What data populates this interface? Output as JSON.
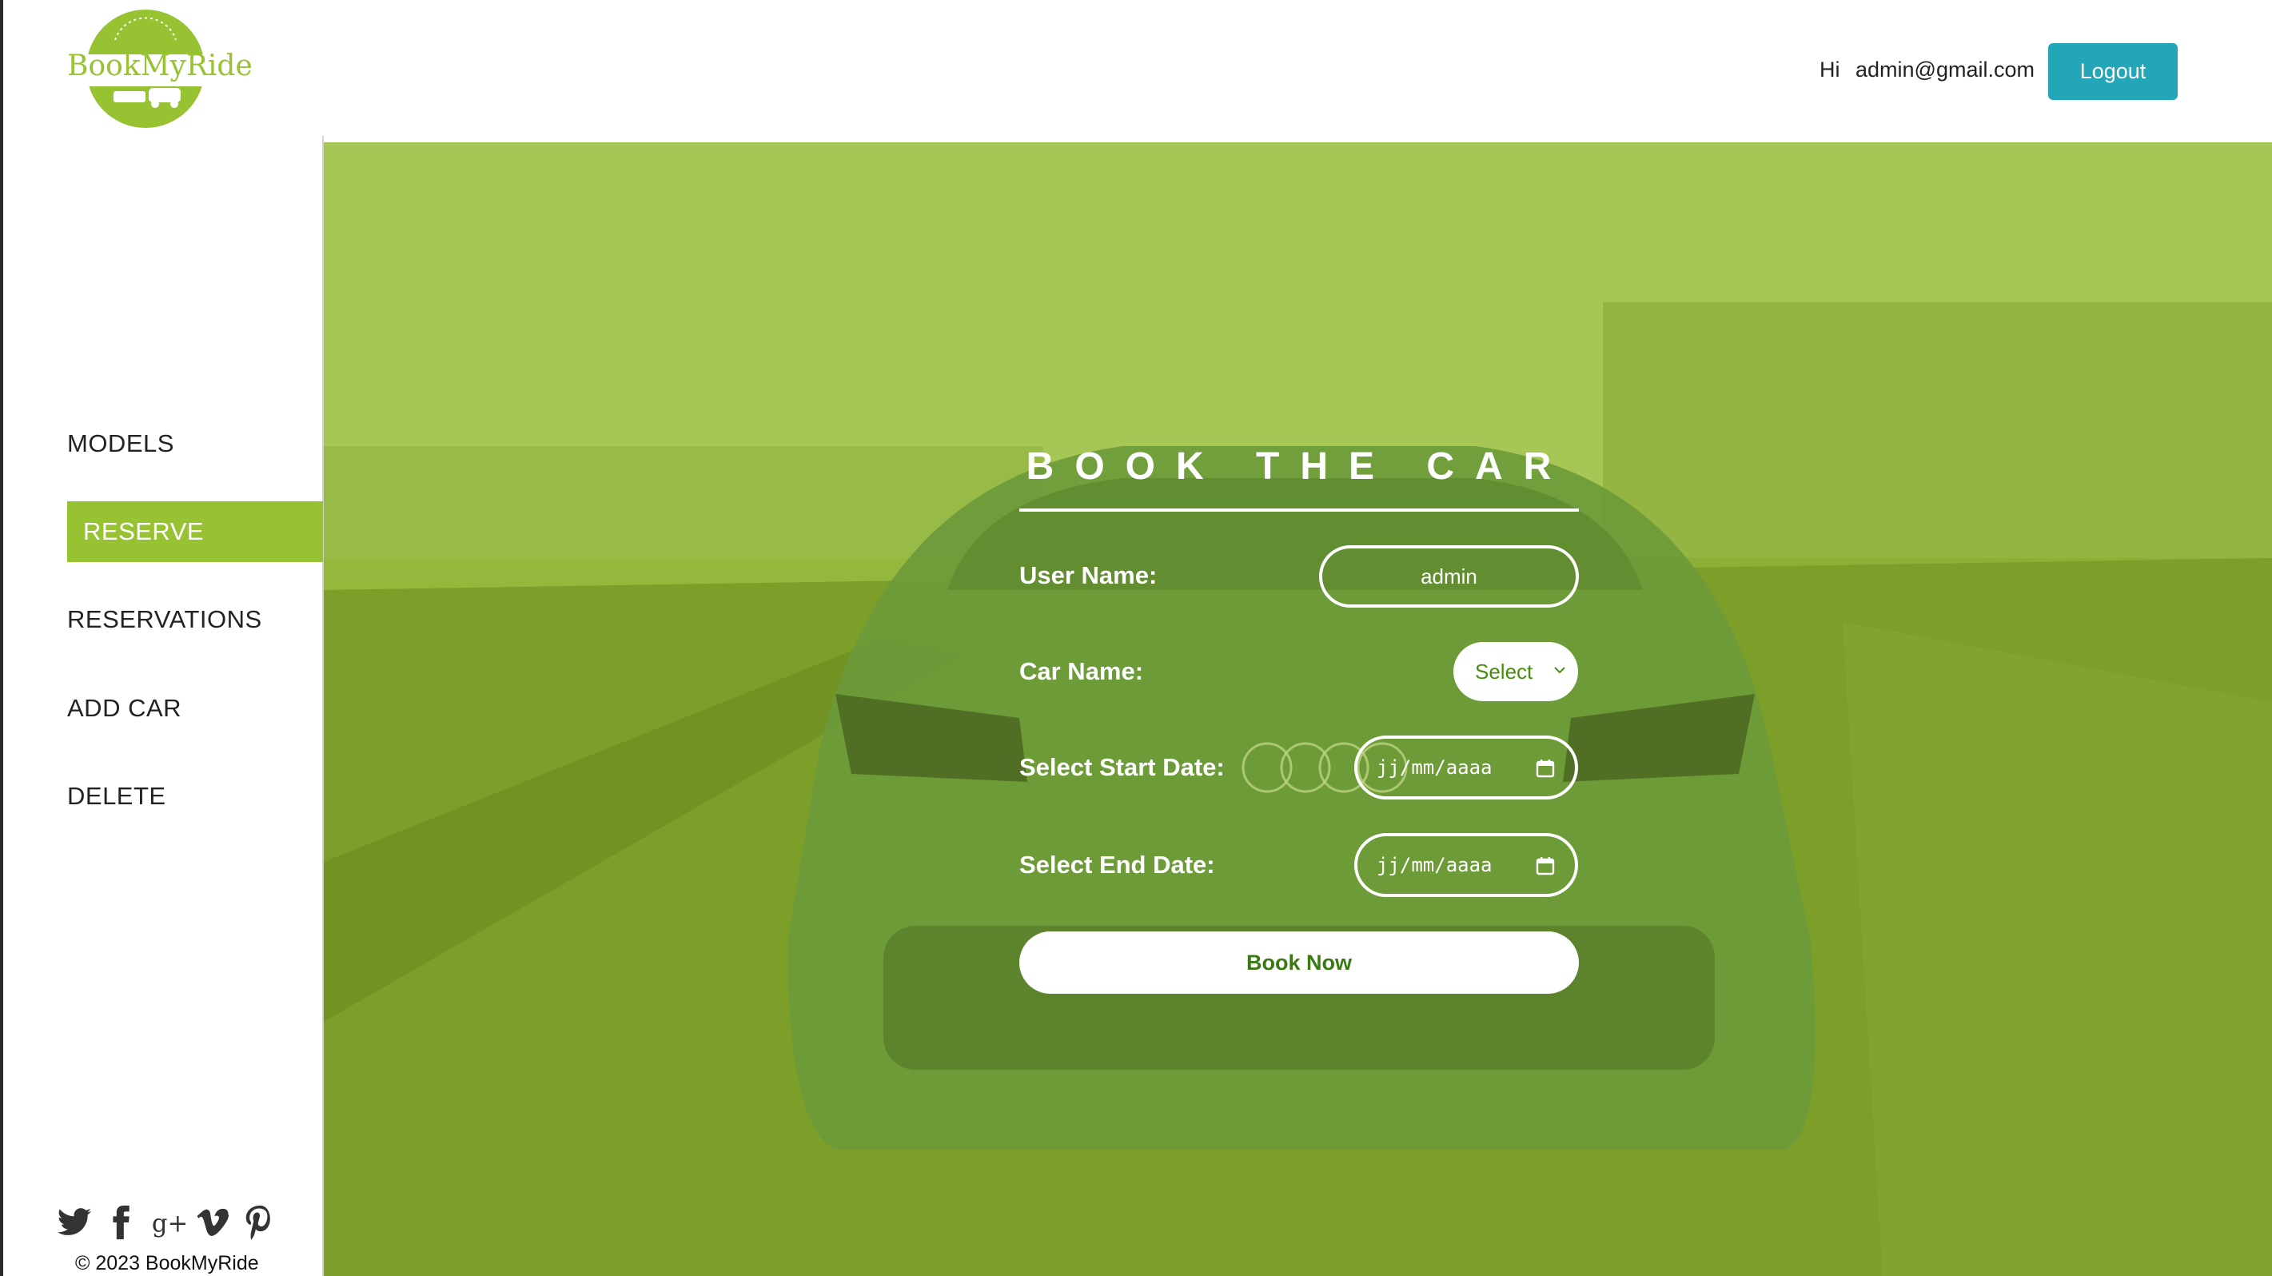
{
  "app": {
    "logo_text": "BookMyRide",
    "brand_color": "#97c232",
    "accent_color": "#22a6b8"
  },
  "header": {
    "greeting": "Hi",
    "user_email": "admin@gmail.com",
    "logout_label": "Logout"
  },
  "sidebar": {
    "items": [
      {
        "label": "MODELS",
        "active": false
      },
      {
        "label": "RESERVE",
        "active": true
      },
      {
        "label": "RESERVATIONS",
        "active": false
      },
      {
        "label": "ADD CAR",
        "active": false
      },
      {
        "label": "DELETE",
        "active": false
      }
    ],
    "socials": [
      "twitter-icon",
      "facebook-icon",
      "google-plus-icon",
      "vimeo-icon",
      "pinterest-icon"
    ],
    "copyright": "© 2023 BookMyRide"
  },
  "form": {
    "title": "BOOK THE CAR",
    "user_name_label": "User Name:",
    "user_name_value": "admin",
    "car_name_label": "Car Name:",
    "car_select_value": "Select",
    "start_date_label": "Select Start Date:",
    "start_date_placeholder": "jj/mm/aaaa",
    "end_date_label": "Select End Date:",
    "end_date_placeholder": "jj/mm/aaaa",
    "submit_label": "Book Now"
  }
}
